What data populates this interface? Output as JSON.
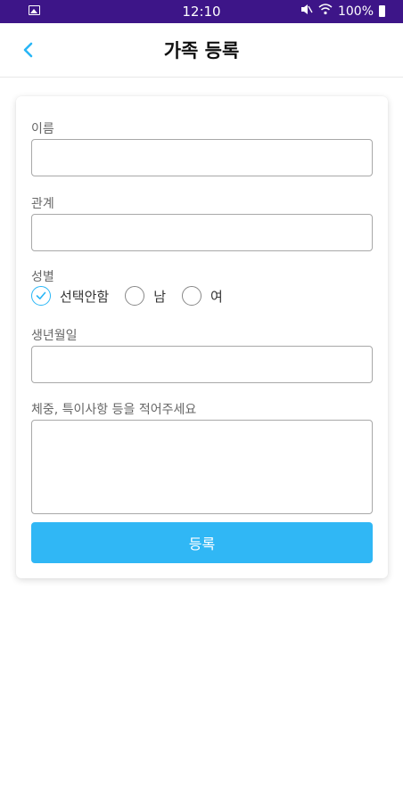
{
  "status_bar": {
    "time": "12:10",
    "battery": "100%",
    "colors": {
      "background": "#3d1588"
    }
  },
  "header": {
    "title": "가족 등록",
    "back_icon": "chevron-left-icon",
    "accent": "#29b6f6"
  },
  "form": {
    "name_label": "이름",
    "name_value": "",
    "relation_label": "관계",
    "relation_value": "",
    "gender_label": "성별",
    "gender_options": [
      {
        "label": "선택안함",
        "selected": true
      },
      {
        "label": "남",
        "selected": false
      },
      {
        "label": "여",
        "selected": false
      }
    ],
    "birth_label": "생년월일",
    "birth_value": "",
    "notes_label": "체중, 특이사항 등을 적어주세요",
    "notes_value": "",
    "submit_label": "등록",
    "submit_color": "#30b7f5"
  }
}
